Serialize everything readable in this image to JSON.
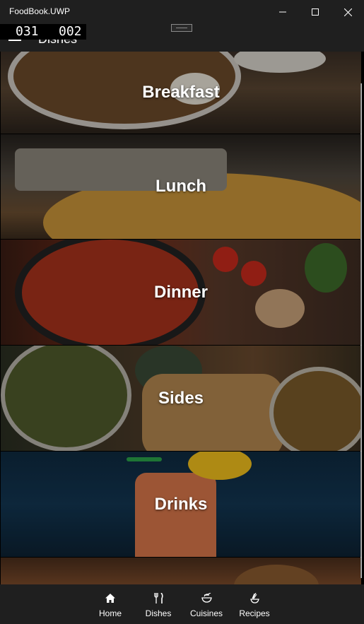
{
  "window": {
    "title": "FoodBook.UWP"
  },
  "header": {
    "title": "Dishes",
    "counter_a": "031",
    "counter_b": "002"
  },
  "categories": [
    {
      "label": "Breakfast"
    },
    {
      "label": "Lunch"
    },
    {
      "label": "Dinner"
    },
    {
      "label": "Sides"
    },
    {
      "label": "Drinks"
    }
  ],
  "bottom_nav": {
    "items": [
      {
        "label": "Home",
        "icon": "home-icon"
      },
      {
        "label": "Dishes",
        "icon": "fork-knife-icon"
      },
      {
        "label": "Cuisines",
        "icon": "bowl-icon"
      },
      {
        "label": "Recipes",
        "icon": "whisk-icon"
      }
    ]
  }
}
